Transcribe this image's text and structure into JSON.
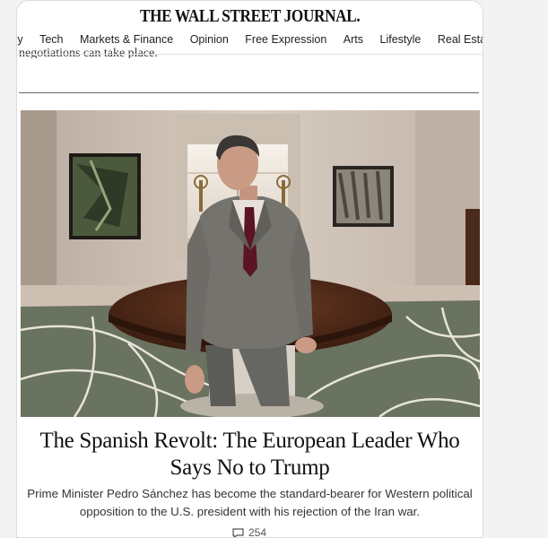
{
  "masthead": {
    "title": "THE WALL STREET JOURNAL."
  },
  "nav": {
    "items": [
      "omy",
      "Tech",
      "Markets & Finance",
      "Opinion",
      "Free Expression",
      "Arts",
      "Lifestyle",
      "Real Estate"
    ]
  },
  "previous_article": {
    "snippet": "negotiations can take place."
  },
  "article": {
    "headline_line1": "The Spanish Revolt: The European Leader Who",
    "headline_line2": "Says No to Trump",
    "dek_line1": "Prime Minister Pedro Sánchez has become the standard-bearer for Western political",
    "dek_line2": "opposition to the U.S. president with his rejection of the Iran war.",
    "comment_count": "254",
    "comment_icon": "speech-bubble-icon",
    "image_alt": "Man in a gray suit seated on a round table in an ornate room"
  },
  "colors": {
    "text": "#111111",
    "background": "#f3f3f3",
    "card": "#ffffff"
  }
}
